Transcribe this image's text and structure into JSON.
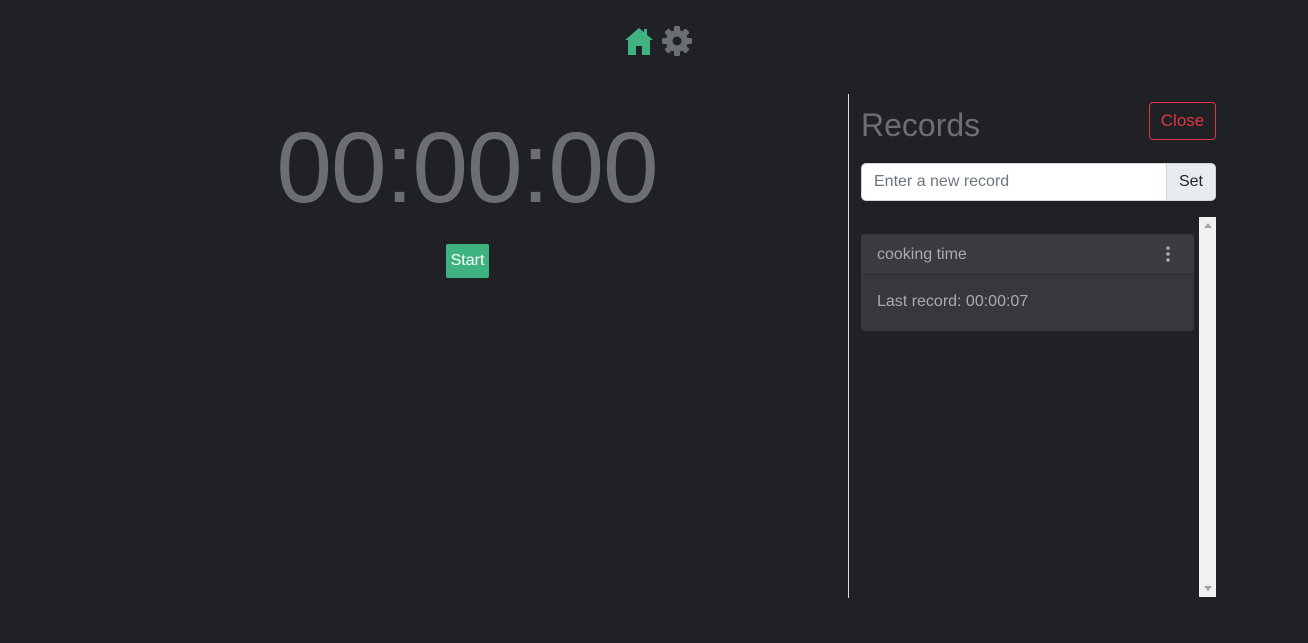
{
  "nav": {
    "home_icon": "home-icon",
    "settings_icon": "gear-icon",
    "home_color": "#3eb37f",
    "settings_color": "#6b6e72"
  },
  "timer": {
    "display": "00:00:00",
    "start_label": "Start"
  },
  "records": {
    "title": "Records",
    "close_label": "Close",
    "input_placeholder": "Enter a new record",
    "input_value": "",
    "set_label": "Set",
    "items": [
      {
        "name": "cooking time",
        "last_record": "Last record: 00:00:07",
        "menu_icon": "kebab-menu-icon"
      }
    ]
  },
  "colors": {
    "background": "#202124",
    "accent_green": "#3eb37f",
    "danger_red": "#dc3545",
    "muted_text": "#6b6e72"
  }
}
